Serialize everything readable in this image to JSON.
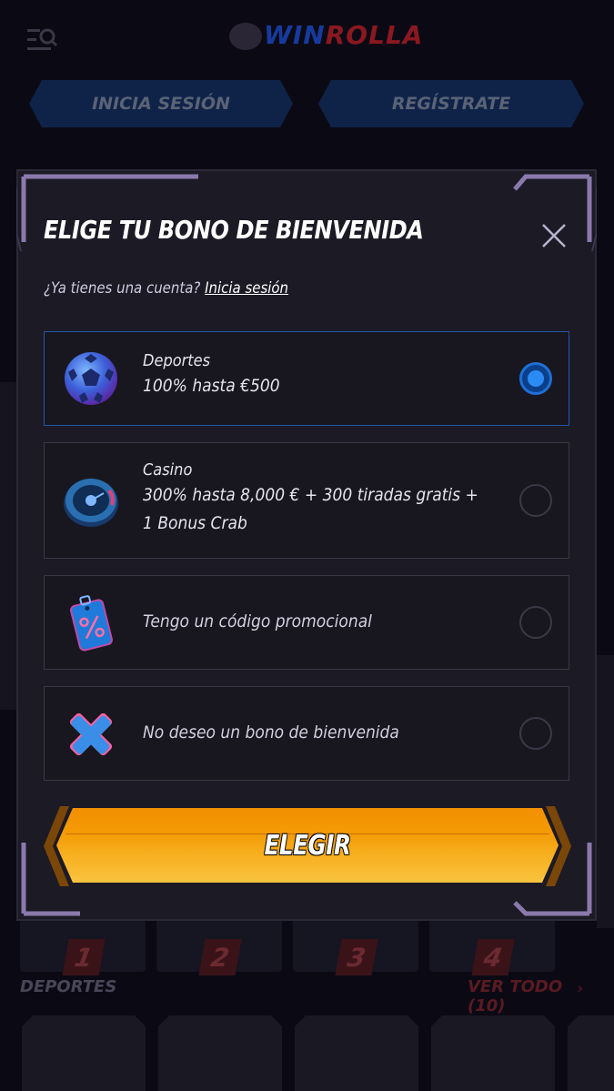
{
  "background": {
    "logo_part1": "WIN",
    "logo_part2": "ROLLA",
    "login_label": "INICIA SESIÓN",
    "register_label": "REGÍSTRATE",
    "card_numbers": [
      "1",
      "2",
      "3",
      "4"
    ],
    "section_title": "DEPORTES",
    "section_more": "VER TODO (10)"
  },
  "modal": {
    "title": "ELIGE TU BONO DE BIENVENIDA",
    "account_question": "¿Ya tienes una cuenta?",
    "account_link": "Inicia sesión",
    "options": [
      {
        "name": "Deportes",
        "detail": "100% hasta €500",
        "icon": "soccer-ball-icon",
        "selected": true
      },
      {
        "name": "Casino",
        "detail": "300% hasta 8,000 € + 300 tiradas gratis + 1 Bonus Crab",
        "icon": "roulette-wheel-icon",
        "selected": false
      },
      {
        "label": "Tengo un código promocional",
        "icon": "promo-tag-icon",
        "selected": false
      },
      {
        "label": "No deseo un bono de bienvenida",
        "icon": "x-mark-icon",
        "selected": false
      }
    ],
    "choose_label": "ELEGIR"
  },
  "colors": {
    "accent_blue": "#1f6fd6",
    "button_orange": "#f49a04",
    "modal_bg": "#1c1a25",
    "frame_purple": "#7a6a9c"
  }
}
